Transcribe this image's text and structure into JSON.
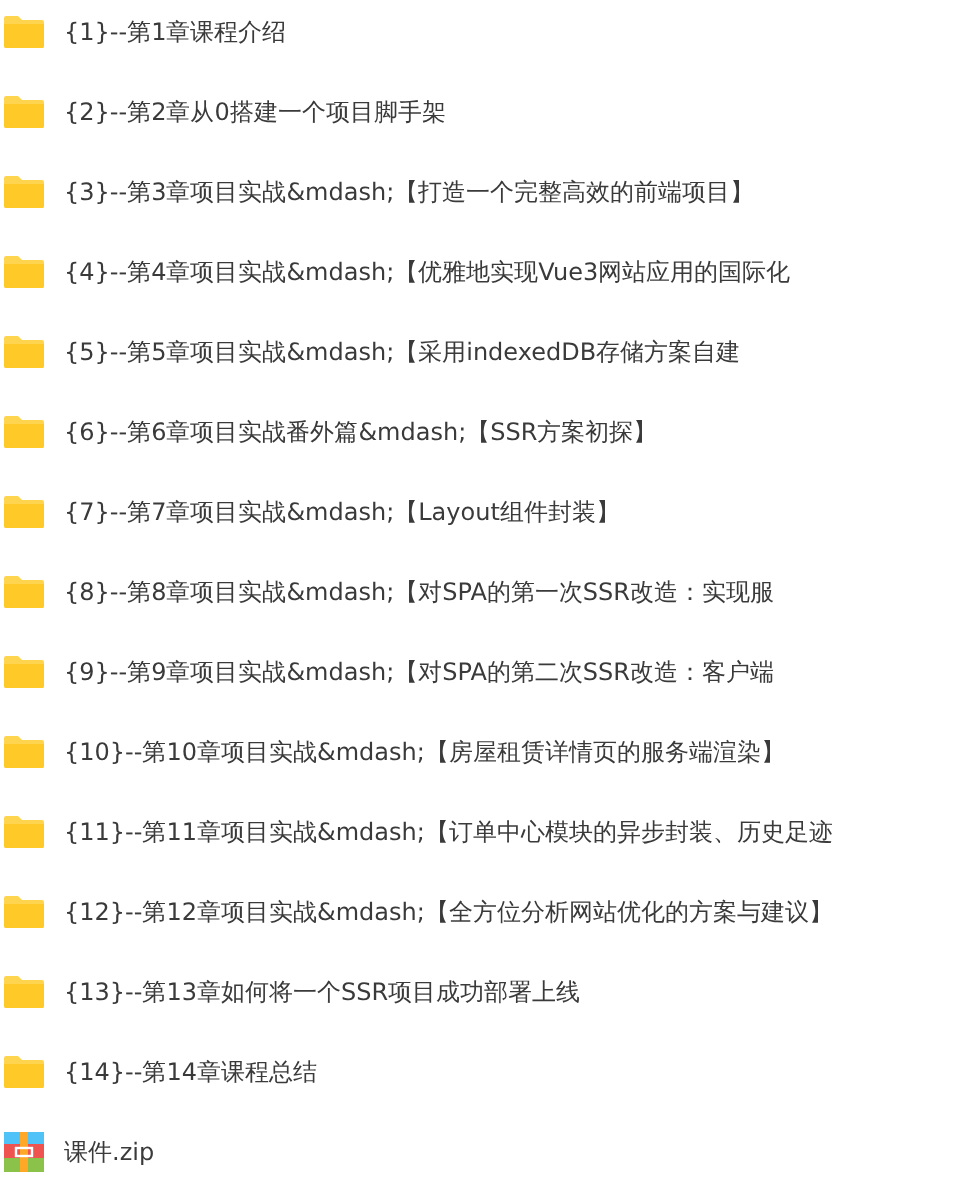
{
  "files": [
    {
      "kind": "folder",
      "name": "{1}--第1章课程介绍"
    },
    {
      "kind": "folder",
      "name": "{2}--第2章从0搭建一个项目脚手架"
    },
    {
      "kind": "folder",
      "name": "{3}--第3章项目实战&mdash;【打造一个完整高效的前端项目】"
    },
    {
      "kind": "folder",
      "name": "{4}--第4章项目实战&mdash;【优雅地实现Vue3网站应用的国际化"
    },
    {
      "kind": "folder",
      "name": "{5}--第5章项目实战&mdash;【采用indexedDB存储方案自建"
    },
    {
      "kind": "folder",
      "name": "{6}--第6章项目实战番外篇&mdash;【SSR方案初探】"
    },
    {
      "kind": "folder",
      "name": "{7}--第7章项目实战&mdash;【Layout组件封装】"
    },
    {
      "kind": "folder",
      "name": "{8}--第8章项目实战&mdash;【对SPA的第一次SSR改造：实现服"
    },
    {
      "kind": "folder",
      "name": "{9}--第9章项目实战&mdash;【对SPA的第二次SSR改造：客户端"
    },
    {
      "kind": "folder",
      "name": "{10}--第10章项目实战&mdash;【房屋租赁详情页的服务端渲染】"
    },
    {
      "kind": "folder",
      "name": "{11}--第11章项目实战&mdash;【订单中心模块的异步封装、历史足迹"
    },
    {
      "kind": "folder",
      "name": "{12}--第12章项目实战&mdash;【全方位分析网站优化的方案与建议】"
    },
    {
      "kind": "folder",
      "name": "{13}--第13章如何将一个SSR项目成功部署上线"
    },
    {
      "kind": "folder",
      "name": "{14}--第14章课程总结"
    },
    {
      "kind": "archive",
      "name": "课件.zip"
    }
  ]
}
